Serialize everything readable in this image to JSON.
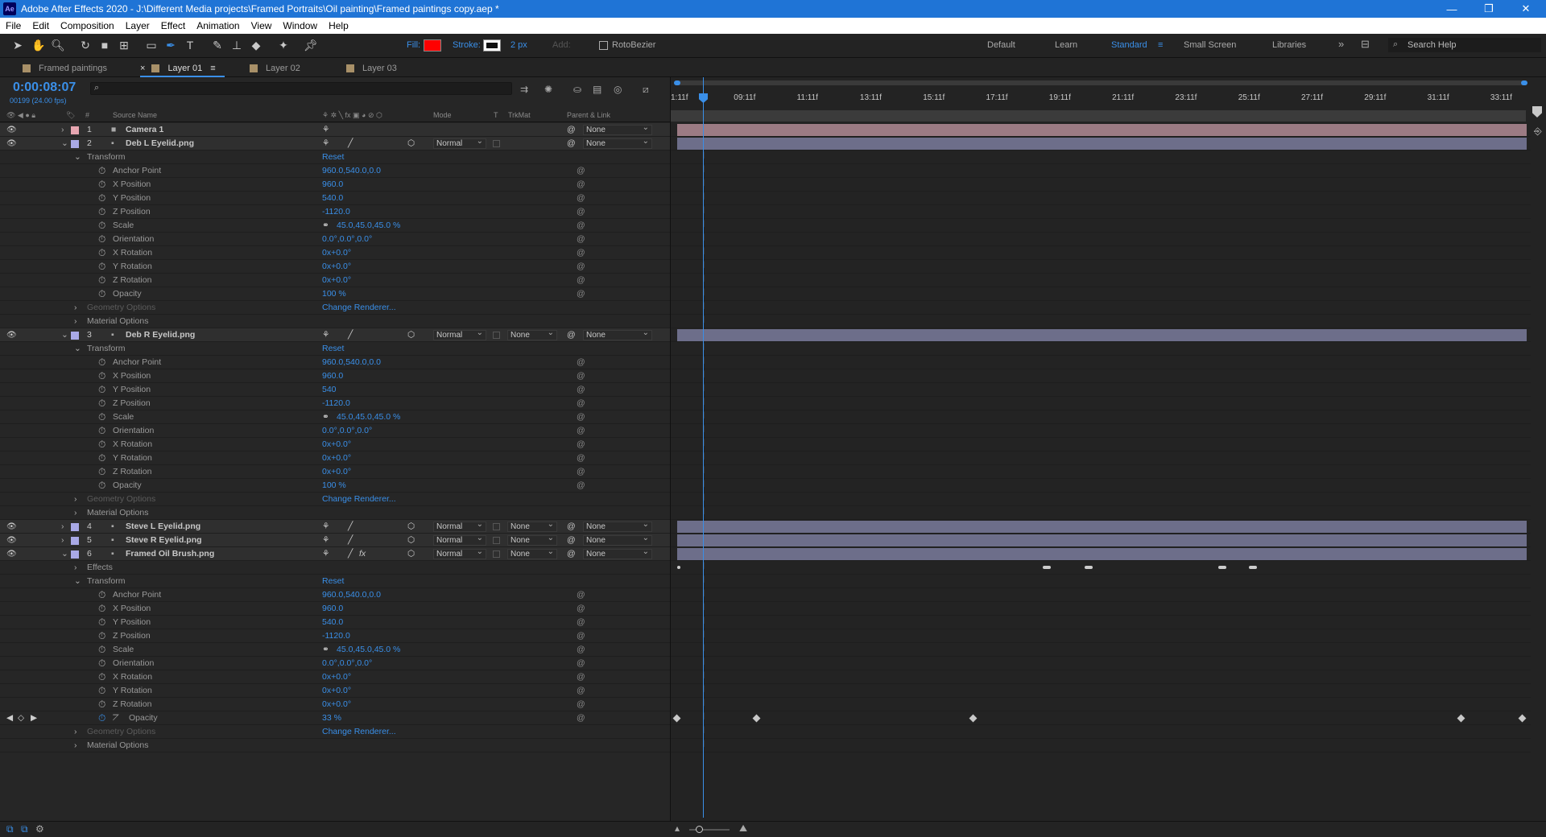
{
  "window": {
    "app_badge": "Ae",
    "title": "Adobe After Effects 2020 - J:\\Different Media projects\\Framed Portraits\\Oil painting\\Framed paintings copy.aep *",
    "min": "—",
    "max": "❐",
    "close": "✕"
  },
  "menu": [
    "File",
    "Edit",
    "Composition",
    "Layer",
    "Effect",
    "Animation",
    "View",
    "Window",
    "Help"
  ],
  "toolbar": {
    "fill_label": "Fill:",
    "fill_color": "#ff0000",
    "stroke_label": "Stroke:",
    "stroke_width": "2 px",
    "add_label": "Add:",
    "rotobezier": "RotoBezier",
    "workspaces": [
      "Default",
      "Learn",
      "Standard",
      "Small Screen",
      "Libraries"
    ],
    "active_workspace": "Standard",
    "search_help": "Search Help"
  },
  "tabs": [
    {
      "label": "Framed paintings",
      "close": ""
    },
    {
      "label": "Layer 01",
      "close": "×",
      "active": true
    },
    {
      "label": "Layer 02"
    },
    {
      "label": "Layer 03"
    }
  ],
  "comp": {
    "timecode": "0:00:08:07",
    "fps": "00199 (24.00 fps)",
    "search_placeholder": "",
    "columns": {
      "num": "#",
      "source": "Source Name",
      "mode": "Mode",
      "t": "T",
      "trkmat": "TrkMat",
      "parent": "Parent & Link"
    }
  },
  "rows": [
    {
      "type": "layer",
      "num": "1",
      "name": "Camera 1",
      "icon": "camera",
      "label_color": "#e7a6b1",
      "mode": "",
      "trkmat": "",
      "parent": "None",
      "bar": "#9c7b84"
    },
    {
      "type": "layer",
      "num": "2",
      "name": "Deb L Eyelid.png",
      "icon": "footage",
      "label_color": "#a9a9e6",
      "mode": "Normal",
      "trkmat": "",
      "parent": "None",
      "bar": "#6d6e8a",
      "open": true
    },
    {
      "type": "group",
      "name": "Transform",
      "value": "Reset"
    },
    {
      "type": "prop",
      "name": "Anchor Point",
      "value": "960.0,540.0,0.0"
    },
    {
      "type": "prop",
      "name": "X Position",
      "value": "960.0"
    },
    {
      "type": "prop",
      "name": "Y Position",
      "value": "540.0"
    },
    {
      "type": "prop",
      "name": "Z Position",
      "value": "-1120.0"
    },
    {
      "type": "prop",
      "name": "Scale",
      "value": "45.0,45.0,45.0 %",
      "link": true
    },
    {
      "type": "prop",
      "name": "Orientation",
      "value": "0.0°,0.0°,0.0°"
    },
    {
      "type": "prop",
      "name": "X Rotation",
      "value": "0x+0.0°"
    },
    {
      "type": "prop",
      "name": "Y Rotation",
      "value": "0x+0.0°"
    },
    {
      "type": "prop",
      "name": "Z Rotation",
      "value": "0x+0.0°"
    },
    {
      "type": "prop",
      "name": "Opacity",
      "value": "100 %"
    },
    {
      "type": "group",
      "name": "Geometry Options",
      "value": "Change Renderer...",
      "dim": true
    },
    {
      "type": "group",
      "name": "Material Options",
      "value": ""
    },
    {
      "type": "layer",
      "num": "3",
      "name": "Deb R Eyelid.png",
      "icon": "footage",
      "label_color": "#a9a9e6",
      "mode": "Normal",
      "trkmat": "None",
      "parent": "None",
      "bar": "#6d6e8a",
      "open": true
    },
    {
      "type": "group",
      "name": "Transform",
      "value": "Reset"
    },
    {
      "type": "prop",
      "name": "Anchor Point",
      "value": "960.0,540.0,0.0"
    },
    {
      "type": "prop",
      "name": "X Position",
      "value": "960.0"
    },
    {
      "type": "prop",
      "name": "Y Position",
      "value": "540"
    },
    {
      "type": "prop",
      "name": "Z Position",
      "value": "-1120.0"
    },
    {
      "type": "prop",
      "name": "Scale",
      "value": "45.0,45.0,45.0 %",
      "link": true
    },
    {
      "type": "prop",
      "name": "Orientation",
      "value": "0.0°,0.0°,0.0°"
    },
    {
      "type": "prop",
      "name": "X Rotation",
      "value": "0x+0.0°"
    },
    {
      "type": "prop",
      "name": "Y Rotation",
      "value": "0x+0.0°"
    },
    {
      "type": "prop",
      "name": "Z Rotation",
      "value": "0x+0.0°"
    },
    {
      "type": "prop",
      "name": "Opacity",
      "value": "100 %"
    },
    {
      "type": "group",
      "name": "Geometry Options",
      "value": "Change Renderer...",
      "dim": true
    },
    {
      "type": "group",
      "name": "Material Options",
      "value": ""
    },
    {
      "type": "layer",
      "num": "4",
      "name": "Steve L Eyelid.png",
      "icon": "footage",
      "label_color": "#a9a9e6",
      "mode": "Normal",
      "trkmat": "None",
      "parent": "None",
      "bar": "#6d6e8a"
    },
    {
      "type": "layer",
      "num": "5",
      "name": "Steve R Eyelid.png",
      "icon": "footage",
      "label_color": "#a9a9e6",
      "mode": "Normal",
      "trkmat": "None",
      "parent": "None",
      "bar": "#6d6e8a"
    },
    {
      "type": "layer",
      "num": "6",
      "name": "Framed Oil Brush.png",
      "icon": "footage",
      "label_color": "#a9a9e6",
      "mode": "Normal",
      "trkmat": "None",
      "parent": "None",
      "bar": "#6d6e8a",
      "open": true,
      "fx": "fx"
    },
    {
      "type": "group",
      "name": "Effects",
      "value": "",
      "closed": true
    },
    {
      "type": "group",
      "name": "Transform",
      "value": "Reset"
    },
    {
      "type": "prop",
      "name": "Anchor Point",
      "value": "960.0,540.0,0.0"
    },
    {
      "type": "prop",
      "name": "X Position",
      "value": "960.0"
    },
    {
      "type": "prop",
      "name": "Y Position",
      "value": "540.0"
    },
    {
      "type": "prop",
      "name": "Z Position",
      "value": "-1120.0"
    },
    {
      "type": "prop",
      "name": "Scale",
      "value": "45.0,45.0,45.0 %",
      "link": true
    },
    {
      "type": "prop",
      "name": "Orientation",
      "value": "0.0°,0.0°,0.0°"
    },
    {
      "type": "prop",
      "name": "X Rotation",
      "value": "0x+0.0°"
    },
    {
      "type": "prop",
      "name": "Y Rotation",
      "value": "0x+0.0°"
    },
    {
      "type": "prop",
      "name": "Z Rotation",
      "value": "0x+0.0°"
    },
    {
      "type": "prop",
      "name": "Opacity",
      "value": "33 %",
      "keyed": true
    },
    {
      "type": "group",
      "name": "Geometry Options",
      "value": "Change Renderer...",
      "dim": true
    },
    {
      "type": "group",
      "name": "Material Options",
      "value": ""
    }
  ],
  "ruler": [
    "1:11f",
    "09:11f",
    "11:11f",
    "13:11f",
    "15:11f",
    "17:11f",
    "19:11f",
    "21:11f",
    "23:11f",
    "25:11f",
    "27:11f",
    "29:11f",
    "31:11f",
    "33:11f"
  ]
}
